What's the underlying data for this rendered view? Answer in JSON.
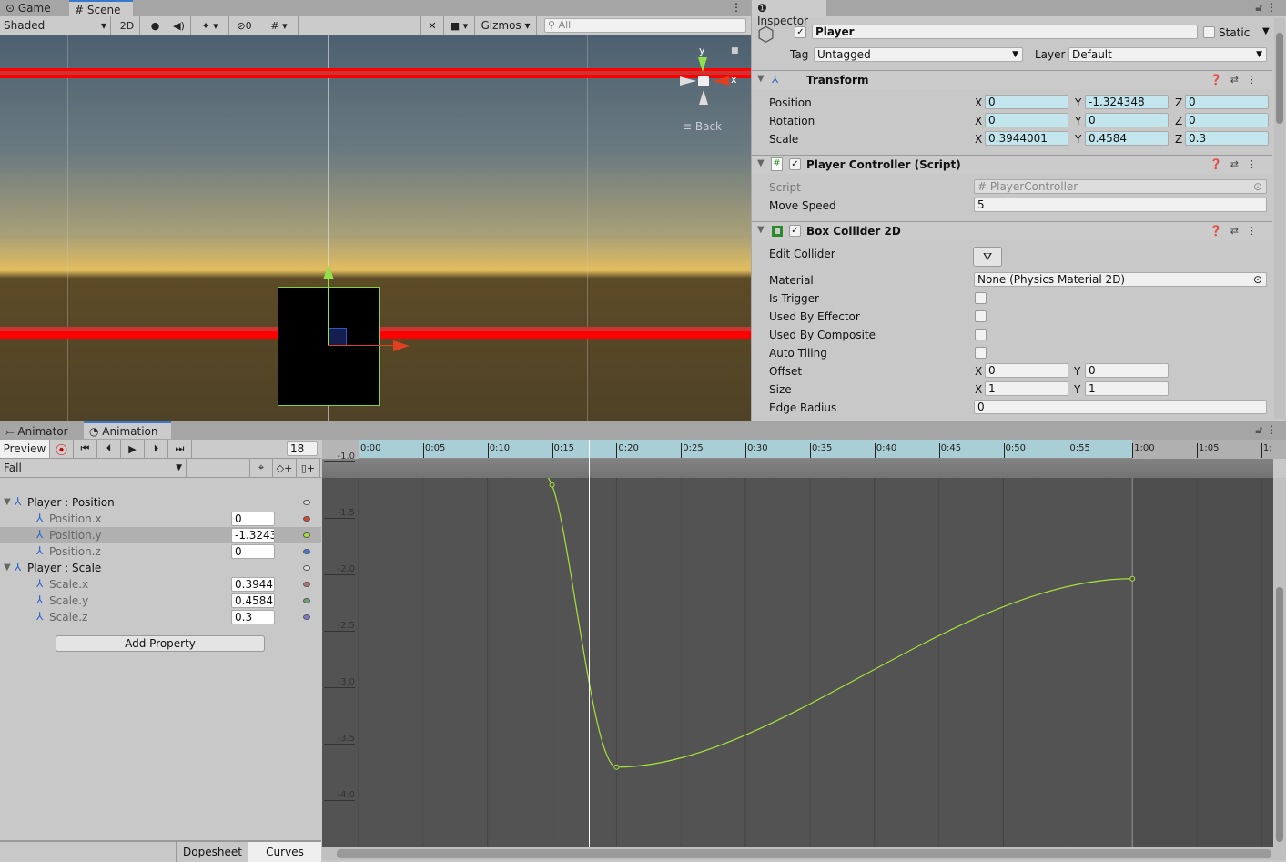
{
  "scene": {
    "tabs": [
      {
        "label": "Game",
        "icon": "gamepad-icon"
      },
      {
        "label": "Scene",
        "icon": "hash-icon",
        "active": true
      }
    ],
    "toolbar": {
      "shading": "Shaded",
      "mode_2d": "2D",
      "hidden_count": "0",
      "gizmos": "Gizmos",
      "search_placeholder": "All"
    },
    "gizmo": {
      "y_label": "y",
      "x_label": "x",
      "back_label": "Back"
    }
  },
  "inspector": {
    "tab": "Inspector",
    "object": {
      "name": "Player",
      "active": true,
      "static_label": "Static",
      "static": false,
      "tag_label": "Tag",
      "tag": "Untagged",
      "layer_label": "Layer",
      "layer": "Default"
    },
    "transform": {
      "title": "Transform",
      "rows": [
        {
          "label": "Position",
          "x": "0",
          "y": "-1.324348",
          "z": "0"
        },
        {
          "label": "Rotation",
          "x": "0",
          "y": "0",
          "z": "0"
        },
        {
          "label": "Scale",
          "x": "0.3944001",
          "y": "0.4584",
          "z": "0.3"
        }
      ]
    },
    "player_controller": {
      "title": "Player Controller (Script)",
      "script_label": "Script",
      "script": "PlayerController",
      "move_speed_label": "Move Speed",
      "move_speed": "5"
    },
    "box_collider": {
      "title": "Box Collider 2D",
      "edit_collider": "Edit Collider",
      "material_label": "Material",
      "material": "None (Physics Material 2D)",
      "checks": [
        {
          "label": "Is Trigger",
          "checked": false
        },
        {
          "label": "Used By Effector",
          "checked": false
        },
        {
          "label": "Used By Composite",
          "checked": false
        },
        {
          "label": "Auto Tiling",
          "checked": false
        }
      ],
      "offset_label": "Offset",
      "offset_x": "0",
      "offset_y": "0",
      "size_label": "Size",
      "size_x": "1",
      "size_y": "1",
      "edge_radius_label": "Edge Radius",
      "edge_radius": "0"
    },
    "axis": {
      "x": "X",
      "y": "Y",
      "z": "Z"
    }
  },
  "animation": {
    "tabs": [
      {
        "label": "Animator"
      },
      {
        "label": "Animation",
        "active": true
      }
    ],
    "preview": "Preview",
    "frame": "18",
    "clip": "Fall",
    "properties": [
      {
        "label": "Player : Position",
        "group": true
      },
      {
        "label": "Position.x",
        "value": "0",
        "color": "#d8452a"
      },
      {
        "label": "Position.y",
        "value": "-1.3243",
        "color": "#a6e23a",
        "selected": true
      },
      {
        "label": "Position.z",
        "value": "0",
        "color": "#3a7be0"
      },
      {
        "label": "Player : Scale",
        "group": true
      },
      {
        "label": "Scale.x",
        "value": "0.3944",
        "color": "#b87070"
      },
      {
        "label": "Scale.y",
        "value": "0.4584",
        "color": "#70a070"
      },
      {
        "label": "Scale.z",
        "value": "0.3",
        "color": "#7a7ad0"
      }
    ],
    "add_property": "Add Property",
    "bottom_tabs": [
      {
        "label": "Dopesheet"
      },
      {
        "label": "Curves",
        "active": true
      }
    ],
    "timeline": [
      "0:00",
      "0:05",
      "0:10",
      "0:15",
      "0:20",
      "0:25",
      "0:30",
      "0:35",
      "0:40",
      "0:45",
      "0:50",
      "0:55",
      "1:00",
      "1:05",
      "1:"
    ]
  },
  "chart_data": {
    "type": "line",
    "series": [
      {
        "name": "Position.y",
        "color": "#a6e23a",
        "keys": [
          [
            15,
            -1.2
          ],
          [
            20,
            -3.7
          ],
          [
            60,
            -2.03
          ]
        ]
      }
    ],
    "y_ticks": [
      "-1.0",
      "-1.5",
      "-2.0",
      "-2.5",
      "-3.0",
      "-3.5",
      "-4.0"
    ],
    "ylim": [
      -4.0,
      -1.0
    ],
    "clip_end_frame": 60,
    "current_frame": 18
  }
}
